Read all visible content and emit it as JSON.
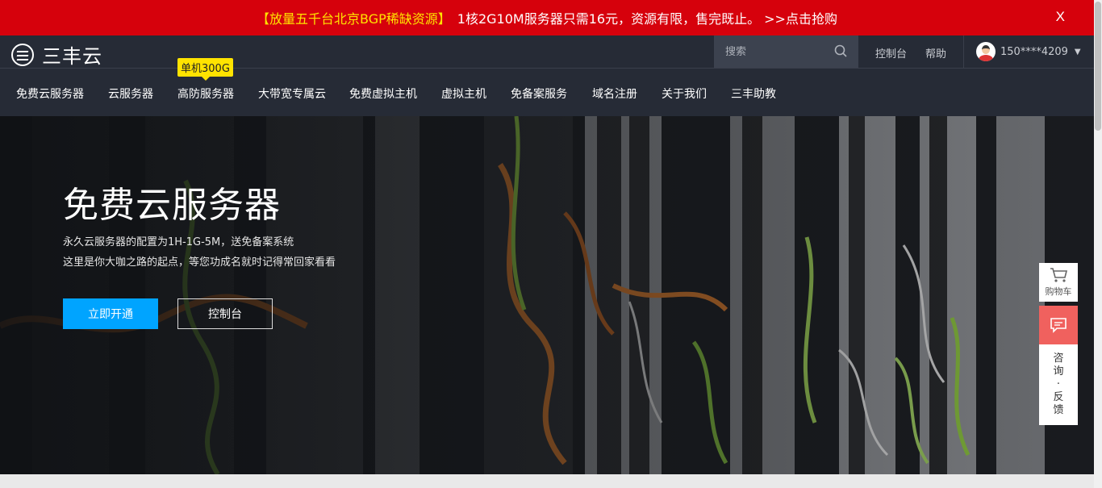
{
  "promo": {
    "highlight": "【放量五千台北京BGP稀缺资源】",
    "text": "1核2G10M服务器只需16元，资源有限，售完既止。 >>点击抢购",
    "close_label": "X"
  },
  "header": {
    "logo_text": "三丰云",
    "search_placeholder": "搜索",
    "console_label": "控制台",
    "help_label": "帮助",
    "user_phone": "150****4209"
  },
  "nav": {
    "badge": "单机300G",
    "items": [
      {
        "label": "免费云服务器"
      },
      {
        "label": "云服务器"
      },
      {
        "label": "高防服务器"
      },
      {
        "label": "大带宽专属云"
      },
      {
        "label": "免费虚拟主机"
      },
      {
        "label": "虚拟主机"
      },
      {
        "label": "免备案服务"
      },
      {
        "label": "域名注册"
      },
      {
        "label": "关于我们"
      },
      {
        "label": "三丰助教"
      }
    ]
  },
  "hero": {
    "title": "免费云服务器",
    "desc_line1": "永久云服务器的配置为1H-1G-5M，送免备案系统",
    "desc_line2": "这里是你大咖之路的起点，等您功成名就时记得常回家看看",
    "primary_button": "立即开通",
    "secondary_button": "控制台"
  },
  "float_tools": {
    "cart_label": "购物车",
    "feedback_chars": [
      "咨",
      "询",
      "·",
      "反",
      "馈"
    ]
  },
  "colors": {
    "promo_bg": "#d6010c",
    "promo_highlight": "#ffe300",
    "header_bg": "#262b36",
    "primary": "#00a4ff",
    "chat": "#f0615e"
  }
}
